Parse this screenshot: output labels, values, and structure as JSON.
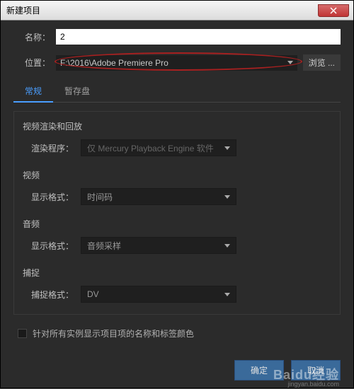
{
  "titlebar": {
    "title": "新建项目"
  },
  "name_row": {
    "label": "名称：",
    "value": "2"
  },
  "location_row": {
    "label": "位置：",
    "value": "F:\\2016\\Adobe Premiere Pro",
    "browse": "浏览 ..."
  },
  "tabs": {
    "general": "常规",
    "scratch": "暂存盘"
  },
  "render_section": {
    "title": "视频渲染和回放",
    "label": "渲染程序：",
    "value": "仅 Mercury Playback Engine 软件"
  },
  "video_section": {
    "title": "视频",
    "label": "显示格式：",
    "value": "时间码"
  },
  "audio_section": {
    "title": "音频",
    "label": "显示格式：",
    "value": "音频采样"
  },
  "capture_section": {
    "title": "捕捉",
    "label": "捕捉格式：",
    "value": "DV"
  },
  "checkbox": {
    "label": "针对所有实例显示项目项的名称和标签颜色"
  },
  "footer": {
    "ok": "确定",
    "cancel": "取消"
  },
  "watermark": {
    "main": "Baidu经验",
    "sub": "jingyan.baidu.com"
  }
}
